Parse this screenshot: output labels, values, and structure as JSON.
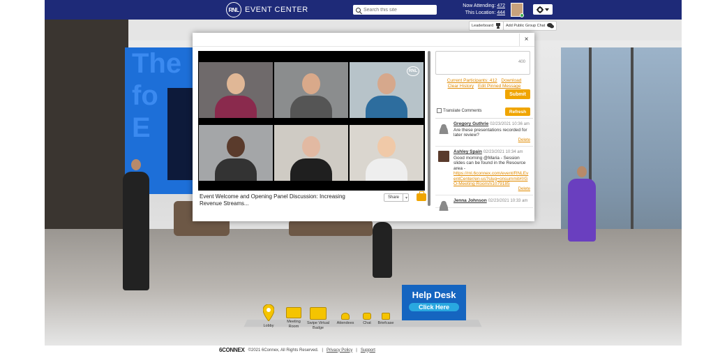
{
  "header": {
    "logo_mark": "RNL",
    "title": "EVENT CENTER",
    "search_placeholder": "Search this site",
    "now_attending_label": "Now Attending:",
    "now_attending_value": "472",
    "this_location_label": "This Location:",
    "this_location_value": "444"
  },
  "toolbar": {
    "leaderboard_label": "Leaderboard",
    "group_chat_label": "Add Public Group Chat"
  },
  "scene": {
    "wall_text": "The\nfo\nE"
  },
  "modal": {
    "close_label": "×",
    "video_badge": "RNL",
    "video_title": "Event Welcome and Opening Panel Discussion: Increasing Revenue Streams...",
    "share_label": "Share",
    "share_caret": "▾"
  },
  "chat": {
    "char_count": "400",
    "link_participants": "Current Participants: 412",
    "link_download": "Download",
    "link_clear": "Clear History",
    "link_pinned": "Edit Pinned Message",
    "submit_label": "Submit",
    "translate_label": "Translate Comments",
    "refresh_label": "Refresh",
    "messages": [
      {
        "name": "Gregory Guthrie",
        "time": "02/23/2021 10:36 am",
        "text": "Are these presentations recorded for later review?",
        "link": "",
        "delete_label": "Delete"
      },
      {
        "name": "Ashley Spain",
        "time": "02/23/2021 10:34 am",
        "text": "Good morning @Maria - Session slides can be found in the Resource area  -",
        "link": "https://rnl.6connex.com/event/RNLEventCenter/en-us?slug=onsummit#!/GO-Meeting-Room/n1079185",
        "delete_label": "Delete"
      },
      {
        "name": "Jenna Johnson",
        "time": "02/23/2021 10:33 am",
        "text": "",
        "link": "",
        "delete_label": ""
      }
    ]
  },
  "dock": {
    "lobby": "Lobby",
    "meeting_room": "Meeting Room",
    "badge": "Swipe Virtual Badge",
    "attendees": "Attendees",
    "chat": "Chat",
    "briefcase": "Briefcase"
  },
  "help_desk": {
    "title": "Help Desk",
    "button": "Click Here"
  },
  "footer": {
    "brand": "6CONNEX",
    "copyright": "©2021 6Connex, All Rights Reserved.",
    "sep1": "|",
    "privacy": "Privacy Policy",
    "sep2": "|",
    "support": "Support"
  }
}
